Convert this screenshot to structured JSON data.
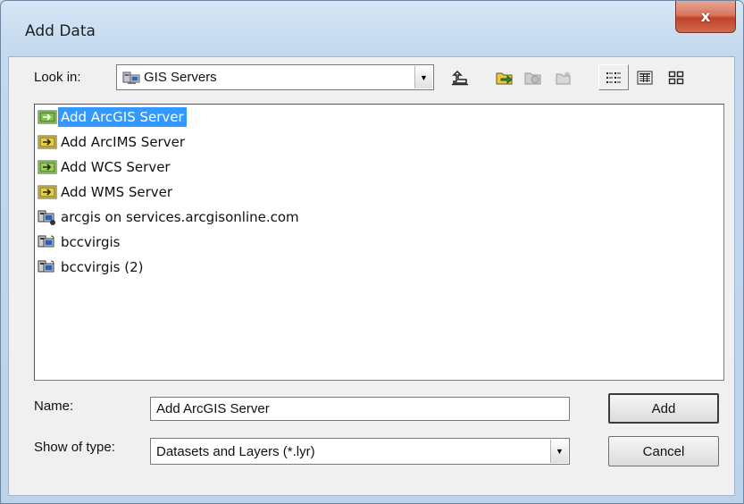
{
  "window": {
    "title": "Add Data",
    "close_glyph": "x"
  },
  "look_in": {
    "label": "Look in:",
    "value": "GIS Servers",
    "icon": "gis-servers-icon",
    "dropdown_glyph": "▼"
  },
  "toolbar": {
    "buttons": [
      "up-one-level",
      "connect-to-folder",
      "disconnect-folder",
      "new-folder",
      "list-view",
      "details-view",
      "thumbnails-view"
    ]
  },
  "list": {
    "items": [
      {
        "label": "Add ArcGIS Server",
        "icon": "add-arcgis-server-icon",
        "selected": true
      },
      {
        "label": "Add ArcIMS Server",
        "icon": "add-arcims-server-icon",
        "selected": false
      },
      {
        "label": "Add WCS Server",
        "icon": "add-wcs-server-icon",
        "selected": false
      },
      {
        "label": "Add WMS Server",
        "icon": "add-wms-server-icon",
        "selected": false
      },
      {
        "label": "arcgis on services.arcgisonline.com",
        "icon": "server-connection-icon",
        "selected": false
      },
      {
        "label": "bccvirgis",
        "icon": "server-connection-icon",
        "selected": false
      },
      {
        "label": "bccvirgis (2)",
        "icon": "server-connection-icon",
        "selected": false
      }
    ]
  },
  "name": {
    "label": "Name:",
    "value": "Add ArcGIS Server"
  },
  "show_of_type": {
    "label": "Show of type:",
    "value": "Datasets and Layers (*.lyr)",
    "dropdown_glyph": "▼"
  },
  "buttons": {
    "add": "Add",
    "cancel": "Cancel"
  },
  "colors": {
    "selection": "#3399ff",
    "close_button": "#c8553d"
  }
}
